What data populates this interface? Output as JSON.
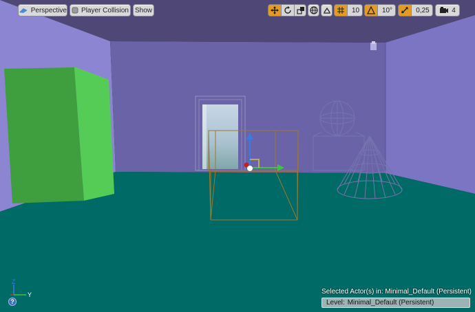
{
  "toolbar": {
    "perspective_label": "Perspective",
    "player_collision_label": "Player Collision",
    "show_label": "Show",
    "grid_snap_value": "10",
    "rotation_snap_value": "10°",
    "scale_snap_value": "0,25",
    "camera_speed_value": "4"
  },
  "icons": {
    "perspective": "perspective-icon",
    "player_collision": "player-collision-icon",
    "translate": "translate-icon",
    "rotate": "rotate-icon",
    "scale": "scale-icon",
    "world_local": "globe-icon",
    "surface_snap": "surface-snap-icon",
    "grid_snap": "grid-snap-icon",
    "rotation_snap": "rotation-snap-icon",
    "scale_snap": "scale-snap-icon",
    "camera_speed": "camera-speed-icon",
    "help": "help-icon"
  },
  "axis_widget": {
    "z_label": "Z",
    "y_label": "Y"
  },
  "status": {
    "selected_actors": "Selected Actor(s) in:  Minimal_Default (Persistent)",
    "level_label": "Level:",
    "level_value": "Minimal_Default (Persistent)"
  },
  "colors": {
    "accent_orange": "#e39b27",
    "floor": "#006b66",
    "walls": "#7f78c8",
    "cube": "#4dcc4d"
  }
}
